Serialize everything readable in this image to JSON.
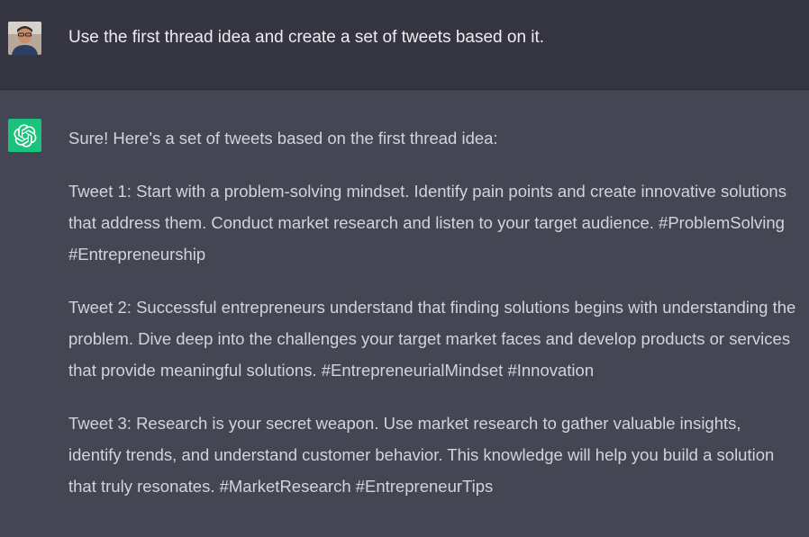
{
  "user_message": {
    "text": "Use the first thread idea and create a set of tweets based on it."
  },
  "assistant_message": {
    "intro": "Sure! Here's a set of tweets based on the first thread idea:",
    "tweets": [
      "Tweet 1: Start with a problem-solving mindset. Identify pain points and create innovative solutions that address them. Conduct market research and listen to your target audience. #ProblemSolving #Entrepreneurship",
      "Tweet 2: Successful entrepreneurs understand that finding solutions begins with understanding the problem. Dive deep into the challenges your target market faces and develop products or services that provide meaningful solutions. #EntrepreneurialMindset #Innovation",
      "Tweet 3: Research is your secret weapon. Use market research to gather valuable insights, identify trends, and understand customer behavior. This knowledge will help you build a solution that truly resonates. #MarketResearch #EntrepreneurTips"
    ]
  },
  "icons": {
    "user_avatar": "user-avatar-photo",
    "assistant_avatar": "openai-logo-icon"
  },
  "colors": {
    "user_bg": "#343541",
    "assistant_bg": "#444654",
    "assistant_icon_bg": "#19c37d",
    "user_text": "#ececf1",
    "assistant_text": "#d1d5db"
  }
}
